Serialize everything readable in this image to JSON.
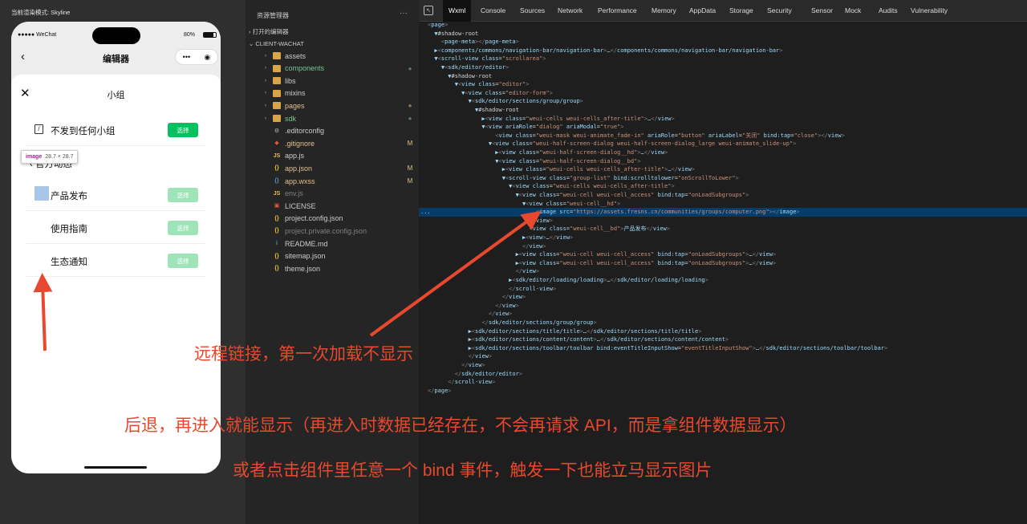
{
  "simulator": {
    "render_mode": "当前渲染模式: Skyline",
    "status_left": "●●●●● WeChat",
    "status_right": "80%",
    "nav_back": "‹",
    "nav_title": "编辑器",
    "capsule_more": "•••",
    "capsule_close": "◉",
    "sheet_close": "✕",
    "sheet_title": "小组",
    "no_post_label": "不发到任何小组",
    "select_label": "选择",
    "section_back": "‹ 官方动态",
    "groups": [
      {
        "name": "产品发布",
        "button": "选择"
      },
      {
        "name": "使用指南",
        "button": "选择"
      },
      {
        "name": "生态通知",
        "button": "选择"
      }
    ],
    "tooltip": {
      "tag": "image",
      "size": "28.7 × 28.7"
    }
  },
  "explorer": {
    "title": "资源管理器",
    "more": "···",
    "open_editors": "打开的编辑器",
    "project": "CLIENT-WACHAT",
    "items": [
      {
        "name": "assets",
        "icon": "folder-icon",
        "folder": true,
        "color": "#cccccc",
        "status": "",
        "status_color": ""
      },
      {
        "name": "components",
        "icon": "folder-icon",
        "folder": true,
        "color": "#73c991",
        "status": "●",
        "status_color": "#5f7a5f"
      },
      {
        "name": "libs",
        "icon": "folder-icon",
        "folder": true,
        "color": "#cccccc",
        "status": "",
        "status_color": ""
      },
      {
        "name": "mixins",
        "icon": "folder-icon",
        "folder": true,
        "color": "#cccccc",
        "status": "",
        "status_color": ""
      },
      {
        "name": "pages",
        "icon": "folder-icon",
        "folder": true,
        "color": "#e2c08d",
        "status": "●",
        "status_color": "#8a7a55"
      },
      {
        "name": "sdk",
        "icon": "folder-icon",
        "folder": true,
        "color": "#73c991",
        "status": "●",
        "status_color": "#5f7a5f"
      },
      {
        "name": ".editorconfig",
        "icon": "gear-file-icon",
        "folder": false,
        "color": "#cccccc",
        "status": "",
        "status_color": ""
      },
      {
        "name": ".gitignore",
        "icon": "git-file-icon",
        "folder": false,
        "color": "#e2c08d",
        "status": "M",
        "status_color": "#e2c08d"
      },
      {
        "name": "app.js",
        "icon": "js-file-icon",
        "folder": false,
        "color": "#cccccc",
        "status": "",
        "status_color": ""
      },
      {
        "name": "app.json",
        "icon": "json-file-icon",
        "folder": false,
        "color": "#e2c08d",
        "status": "M",
        "status_color": "#e2c08d"
      },
      {
        "name": "app.wxss",
        "icon": "css-file-icon",
        "folder": false,
        "color": "#e2c08d",
        "status": "M",
        "status_color": "#e2c08d"
      },
      {
        "name": "env.js",
        "icon": "js-file-icon",
        "folder": false,
        "color": "#7f7f7f",
        "status": "",
        "status_color": ""
      },
      {
        "name": "LICENSE",
        "icon": "license-file-icon",
        "folder": false,
        "color": "#cccccc",
        "status": "",
        "status_color": ""
      },
      {
        "name": "project.config.json",
        "icon": "json-file-icon",
        "folder": false,
        "color": "#cccccc",
        "status": "",
        "status_color": ""
      },
      {
        "name": "project.private.config.json",
        "icon": "json-file-icon",
        "folder": false,
        "color": "#7f7f7f",
        "status": "",
        "status_color": ""
      },
      {
        "name": "README.md",
        "icon": "info-file-icon",
        "folder": false,
        "color": "#cccccc",
        "status": "",
        "status_color": ""
      },
      {
        "name": "sitemap.json",
        "icon": "json-file-icon",
        "folder": false,
        "color": "#cccccc",
        "status": "",
        "status_color": ""
      },
      {
        "name": "theme.json",
        "icon": "json-file-icon",
        "folder": false,
        "color": "#cccccc",
        "status": "",
        "status_color": ""
      }
    ]
  },
  "devtools": {
    "tabs": [
      "Wxml",
      "Console",
      "Sources",
      "Network",
      "Performance",
      "Memory",
      "AppData",
      "Storage",
      "Security",
      "Sensor",
      "Mock",
      "Audits",
      "Vulnerability"
    ],
    "active_tab": "Wxml",
    "code_lines": [
      "<page>",
      "  ▼#shadow-root",
      "    <page-meta></page-meta>",
      "  ▶<components/commons/navigation-bar/navigation-bar>…</components/commons/navigation-bar/navigation-bar>",
      "  ▼<scroll-view class=\"scrollarea\">",
      "    ▼<sdk/editor/editor>",
      "      ▼#shadow-root",
      "        ▼<view class=\"editor\">",
      "          ▼<view class=\"editor-form\">",
      "            ▼<sdk/editor/sections/group/group>",
      "              ▼#shadow-root",
      "                ▶<view class=\"weui-cells weui-cells_after-title\">…</view>",
      "                ▼<view ariaRole=\"dialog\" ariaModal=\"true\">",
      "                    <view class=\"weui-mask weui-animate_fade-in\" ariaRole=\"button\" ariaLabel=\"关闭\" bind:tap=\"close\"></view>",
      "                  ▼<view class=\"weui-half-screen-dialog weui-half-screen-dialog_large weui-animate_slide-up\">",
      "                    ▶<view class=\"weui-half-screen-dialog__hd\">…</view>",
      "                    ▼<view class=\"weui-half-screen-dialog__bd\">",
      "                      ▶<view class=\"weui-cells weui-cells_after-title\">…</view>",
      "                      ▼<scroll-view class=\"group-list\" bind:scrolltolower=\"onScrollToLower\">",
      "                        ▼<view class=\"weui-cells weui-cells_after-title\">",
      "                          ▼<view class=\"weui-cell weui-cell_access\" bind:tap=\"onLoadSubgroups\">",
      "                            ▼<view class=\"weui-cell__hd\">",
      "                                <image src=\"https://assets.fresns.cn/communities/groups/computer.png\"></image>",
      "                              </view>",
      "                              <view class=\"weui-cell__bd\">产品发布</view>",
      "                            ▶<view>…</view>",
      "                            </view>",
      "                          ▶<view class=\"weui-cell weui-cell_access\" bind:tap=\"onLoadSubgroups\">…</view>",
      "                          ▶<view class=\"weui-cell weui-cell_access\" bind:tap=\"onLoadSubgroups\">…</view>",
      "                          </view>",
      "                        ▶<sdk/editor/loading/loading>…</sdk/editor/loading/loading>",
      "                        </scroll-view>",
      "                      </view>",
      "                    </view>",
      "                  </view>",
      "                </sdk/editor/sections/group/group>",
      "            ▶<sdk/editor/sections/title/title>…</sdk/editor/sections/title/title>",
      "            ▶<sdk/editor/sections/content/content>…</sdk/editor/sections/content/content>",
      "            ▶<sdk/editor/sections/toolbar/toolbar bind:eventTitleInputShow=\"eventTitleInputShow\">…</sdk/editor/sections/toolbar/toolbar>",
      "            </view>",
      "          </view>",
      "        </sdk/editor/editor>",
      "      </scroll-view>",
      "</page>"
    ],
    "selected_line": 22,
    "selected_marker": "..."
  },
  "annotations": {
    "line1": "远程链接，第一次加载不显示",
    "line2": "后退，再进入就能显示（再进入时数据已经存在，不会再请求 API，而是拿组件数据显示）",
    "line3": "或者点击组件里任意一个 bind 事件，触发一下也能立马显示图片",
    "color": "#e8492e"
  }
}
